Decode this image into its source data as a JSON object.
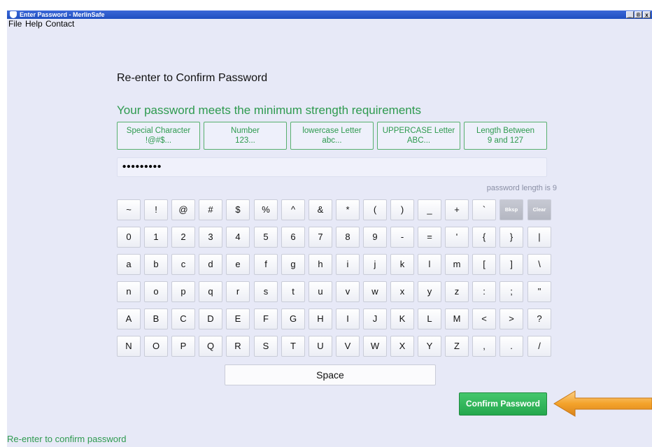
{
  "window": {
    "title": "Enter Password - MerlinSafe",
    "controls": {
      "minimize": "_",
      "restore": "®",
      "close": "x"
    }
  },
  "menu": [
    "File",
    "Help",
    "Contact"
  ],
  "heading": "Re-enter to Confirm Password",
  "strength_message": "Your password meets the minimum strength requirements",
  "requirements": [
    {
      "line1": "Special Character",
      "line2": "!@#$..."
    },
    {
      "line1": "Number",
      "line2": "123..."
    },
    {
      "line1": "lowercase Letter",
      "line2": "abc..."
    },
    {
      "line1": "UPPERCASE Letter",
      "line2": "ABC..."
    },
    {
      "line1": "Length Between",
      "line2": "9 and 127"
    }
  ],
  "password_field": {
    "value": "•••••••••"
  },
  "password_length_text": "password length is 9",
  "keyboard": {
    "rows": [
      [
        "~",
        "!",
        "@",
        "#",
        "$",
        "%",
        "^",
        "&",
        "*",
        "(",
        ")",
        "_",
        "+",
        "`",
        "Bksp",
        "Clear"
      ],
      [
        "0",
        "1",
        "2",
        "3",
        "4",
        "5",
        "6",
        "7",
        "8",
        "9",
        "-",
        "=",
        "'",
        "{",
        "}",
        "|"
      ],
      [
        "a",
        "b",
        "c",
        "d",
        "e",
        "f",
        "g",
        "h",
        "i",
        "j",
        "k",
        "l",
        "m",
        "[",
        "]",
        "\\"
      ],
      [
        "n",
        "o",
        "p",
        "q",
        "r",
        "s",
        "t",
        "u",
        "v",
        "w",
        "x",
        "y",
        "z",
        ":",
        ";",
        "\""
      ],
      [
        "A",
        "B",
        "C",
        "D",
        "E",
        "F",
        "G",
        "H",
        "I",
        "J",
        "K",
        "L",
        "M",
        "<",
        ">",
        "?"
      ],
      [
        "N",
        "O",
        "P",
        "Q",
        "R",
        "S",
        "T",
        "U",
        "V",
        "W",
        "X",
        "Y",
        "Z",
        ",",
        ".",
        "/"
      ]
    ],
    "space_label": "Space"
  },
  "confirm_button": "Confirm Password",
  "status_text": "Re-enter to confirm password",
  "colors": {
    "accent_green": "#2e9a4f",
    "button_green": "#2cb357",
    "arrow_orange": "#f4a32b",
    "background": "#e7e9f7"
  }
}
